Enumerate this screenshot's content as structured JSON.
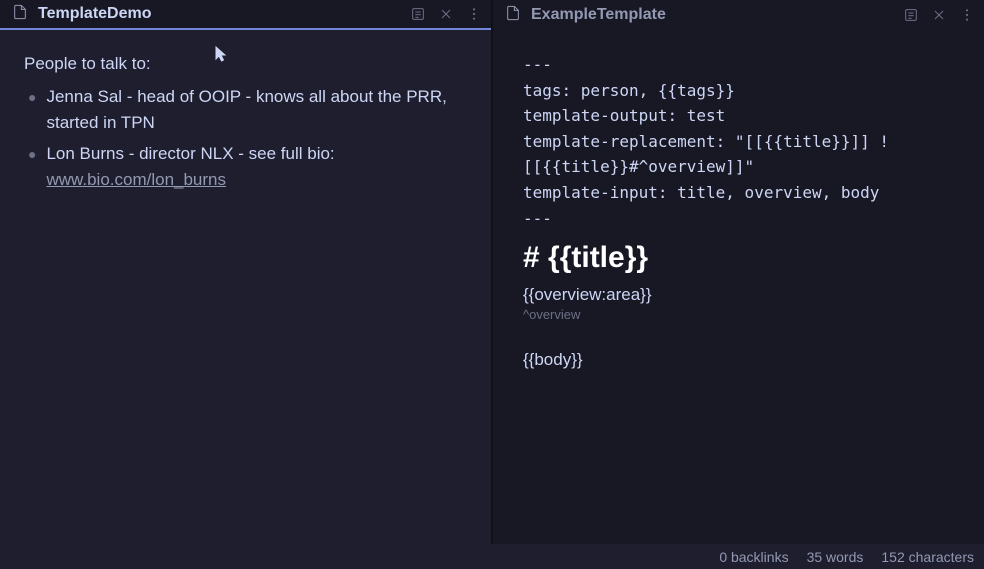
{
  "left": {
    "tab_title": "TemplateDemo",
    "heading": "People to talk to:",
    "bullet1": "Jenna Sal - head of OOIP - knows all about the PRR, started in TPN",
    "bullet2_prefix": "Lon Burns - director NLX - see full bio: ",
    "bullet2_link": "www.bio.com/lon_burns"
  },
  "right": {
    "tab_title": "ExampleTemplate",
    "frontmatter": "---\ntags: person, {{tags}}\ntemplate-output: test\ntemplate-replacement: \"[[{{title}}]] ![[{{title}}#^overview]]\"\ntemplate-input: title, overview, body\n---",
    "h1": "# {{title}}",
    "overview": "{{overview:area}}",
    "blockref": "^overview",
    "body": "{{body}}"
  },
  "status": {
    "backlinks": "0 backlinks",
    "words": "35 words",
    "chars": "152 characters"
  }
}
